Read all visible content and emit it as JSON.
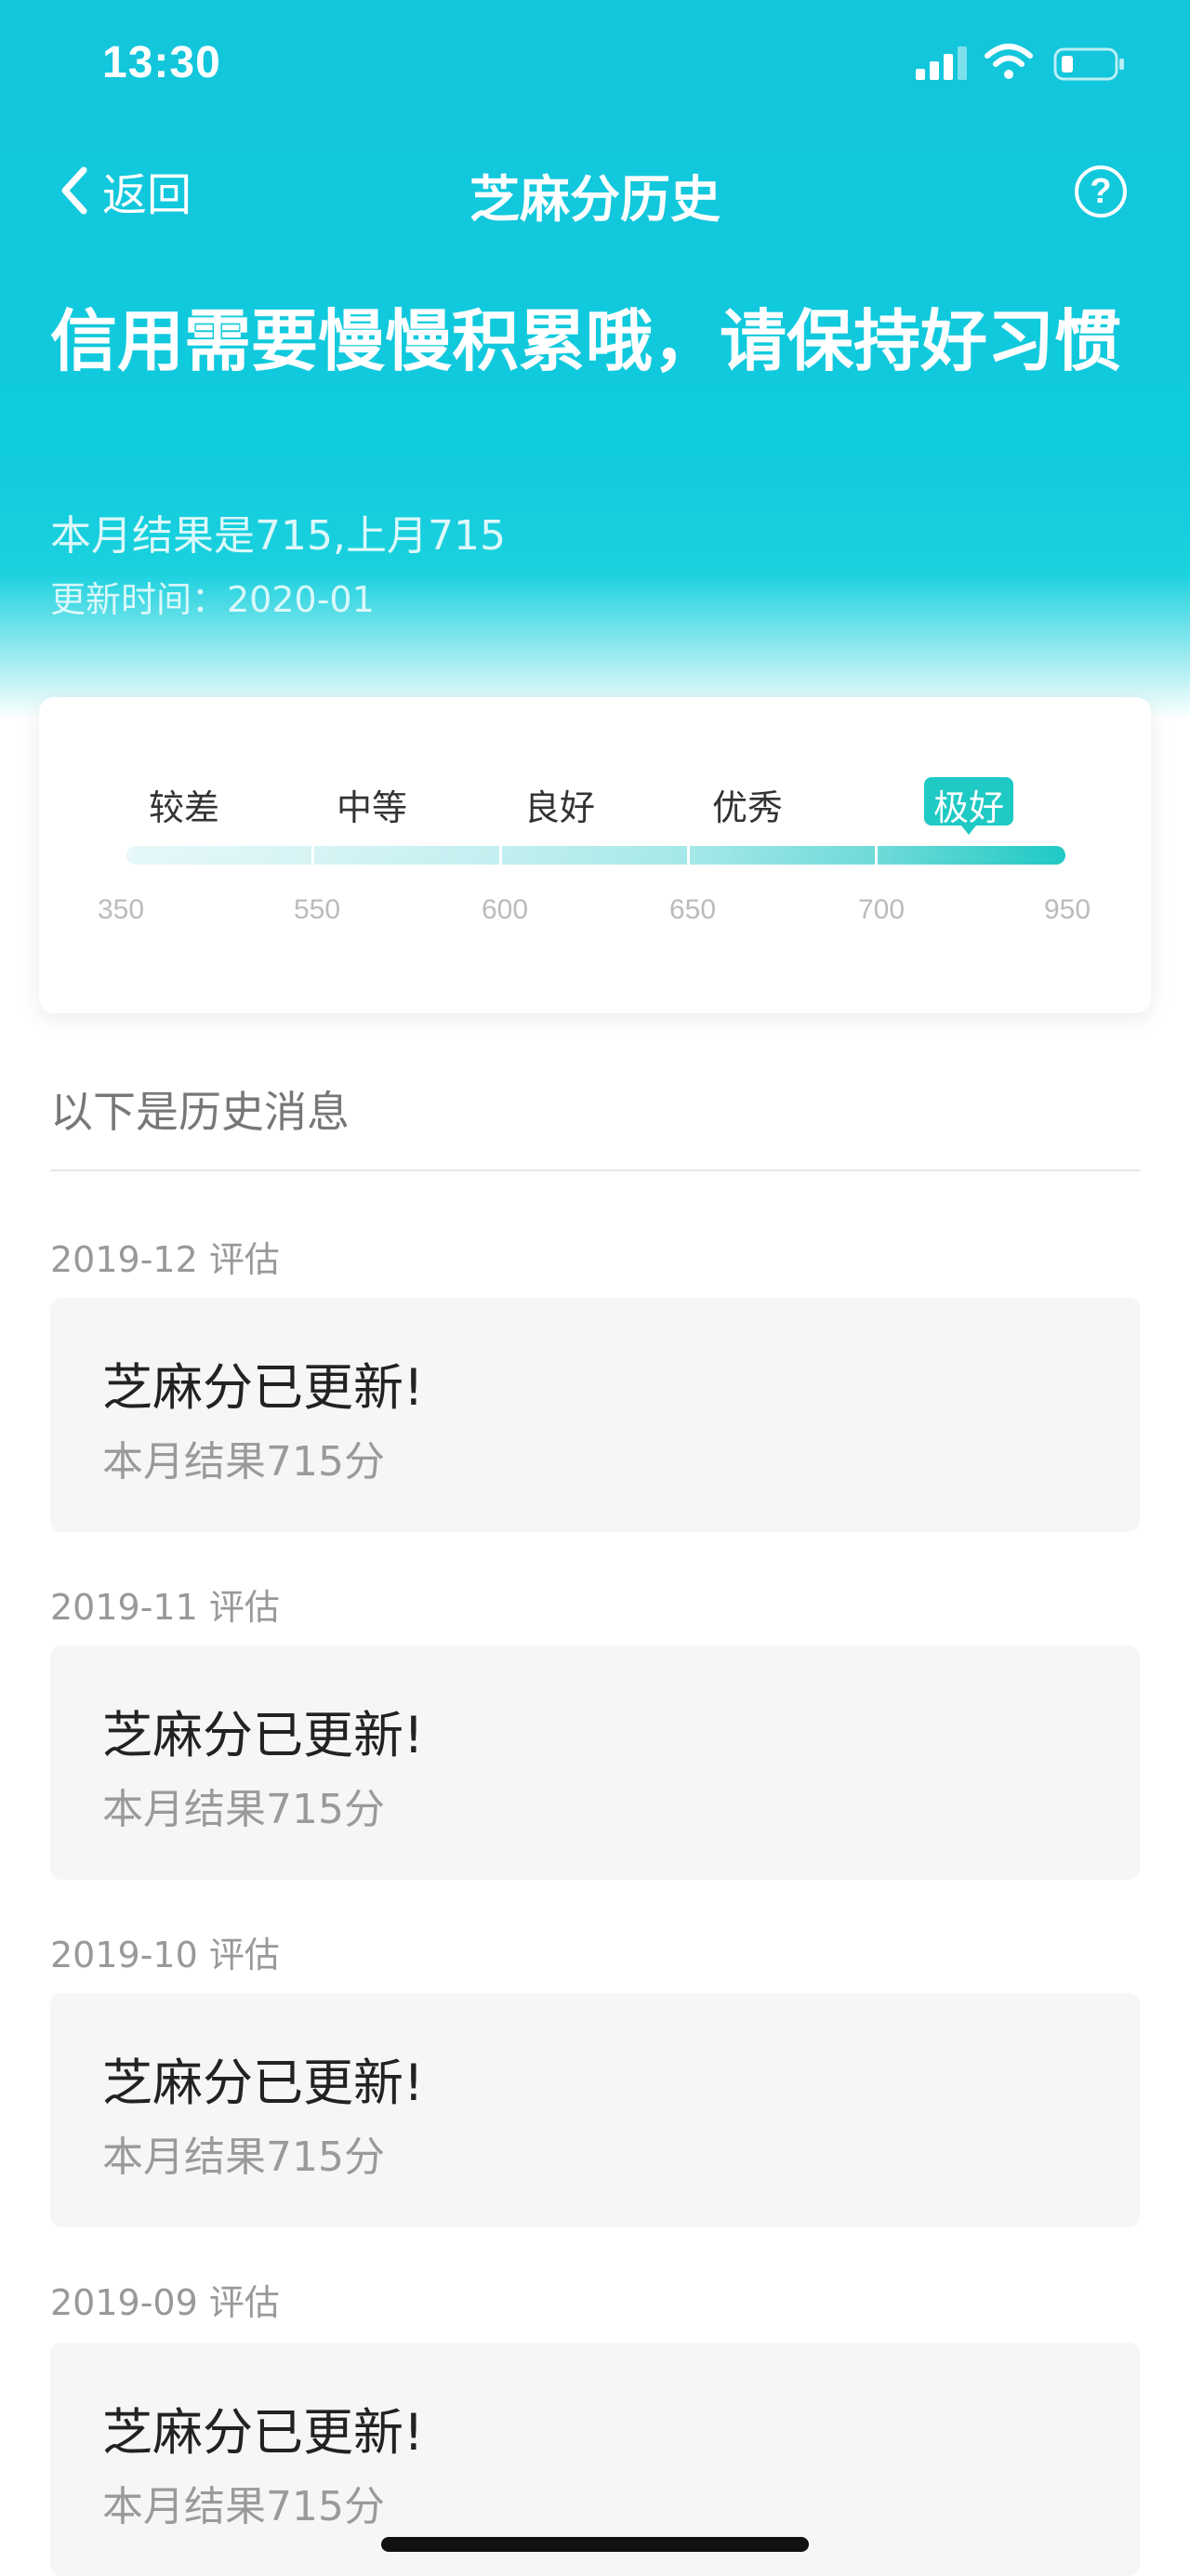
{
  "status_bar": {
    "time": "13:30"
  },
  "nav": {
    "back_label": "返回",
    "title": "芝麻分历史",
    "help_symbol": "?"
  },
  "hero": {
    "headline": "信用需要慢慢积累哦，请保持好习惯",
    "summary": "本月结果是715,上月715",
    "updated": "更新时间：2020-01"
  },
  "score_card": {
    "levels": [
      "较差",
      "中等",
      "良好",
      "优秀",
      "极好"
    ],
    "active_level": "极好",
    "ticks": [
      "350",
      "550",
      "600",
      "650",
      "700",
      "950"
    ],
    "current_score": 715,
    "colors": {
      "accent": "#1fc9c4",
      "bar_start": "#e3f7f8",
      "bar_end": "#1fc9c4"
    }
  },
  "history": {
    "section_title": "以下是历史消息",
    "entries": [
      {
        "date": "2019-12 评估",
        "title": "芝麻分已更新!",
        "detail": "本月结果715分"
      },
      {
        "date": "2019-11 评估",
        "title": "芝麻分已更新!",
        "detail": "本月结果715分"
      },
      {
        "date": "2019-10 评估",
        "title": "芝麻分已更新!",
        "detail": "本月结果715分"
      },
      {
        "date": "2019-09 评估",
        "title": "芝麻分已更新!",
        "detail": "本月结果715分"
      }
    ]
  },
  "icons": {
    "signal": "signal-icon",
    "wifi": "wifi-icon",
    "battery": "battery-icon",
    "back": "chevron-left-icon",
    "help": "help-circle-icon"
  }
}
